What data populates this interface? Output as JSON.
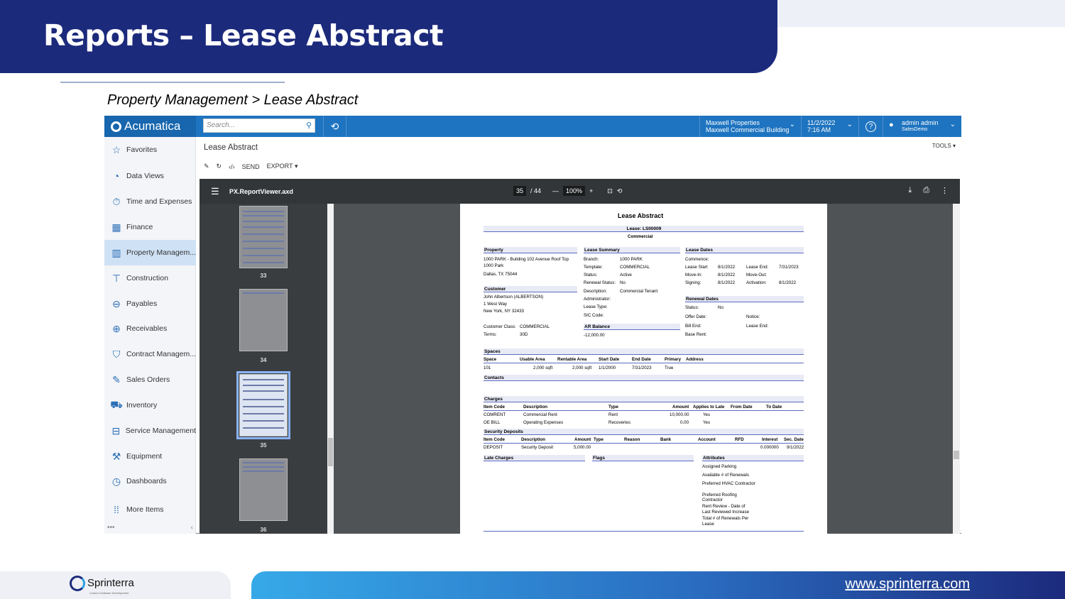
{
  "slide": {
    "title": "Reports – Lease Abstract",
    "breadcrumb": "Property Management > Lease Abstract",
    "url": "www.sprinterra.com",
    "brand": "Sprinterra",
    "brand_tagline": "Custom Software Development"
  },
  "app": {
    "logo": "Acumatica",
    "search_placeholder": "Search...",
    "company": "Maxwell Properties",
    "branch": "Maxwell Commercial Building",
    "date": "11/2/2022",
    "time": "7:16 AM",
    "user": "admin admin",
    "tenant": "SalesDemo"
  },
  "sidebar": {
    "items": [
      {
        "label": "Favorites",
        "icon": "star-icon"
      },
      {
        "label": "Data Views",
        "icon": "pie-chart-icon"
      },
      {
        "label": "Time and Expenses",
        "icon": "stopwatch-icon"
      },
      {
        "label": "Finance",
        "icon": "calculator-icon"
      },
      {
        "label": "Property Managem...",
        "icon": "building-icon"
      },
      {
        "label": "Construction",
        "icon": "crane-icon"
      },
      {
        "label": "Payables",
        "icon": "minus-circle-icon"
      },
      {
        "label": "Receivables",
        "icon": "plus-circle-icon"
      },
      {
        "label": "Contract Managem...",
        "icon": "handshake-icon"
      },
      {
        "label": "Sales Orders",
        "icon": "pencil-icon"
      },
      {
        "label": "Inventory",
        "icon": "truck-icon"
      },
      {
        "label": "Service Management",
        "icon": "toolbox-icon"
      },
      {
        "label": "Equipment",
        "icon": "wrench-icon"
      },
      {
        "label": "Dashboards",
        "icon": "gauge-icon"
      },
      {
        "label": "More Items",
        "icon": "grid-dots-icon"
      }
    ]
  },
  "screen": {
    "title": "Lease Abstract",
    "tools": "TOOLS",
    "send": "SEND",
    "export": "EXPORT"
  },
  "viewer": {
    "filename": "PX.ReportViewer.axd",
    "page": "35",
    "total": "/ 44",
    "zoom": "100%",
    "thumbs": [
      "33",
      "34",
      "35",
      "36"
    ]
  },
  "report": {
    "title": "Lease Abstract",
    "lease": "Lease: LS00009",
    "type": "Commercial",
    "property_h": "Property",
    "property": [
      "1000 PARK - Building 102 Avenue Roof Top",
      "1000 Park",
      "Dallas, TX 75044"
    ],
    "customer_h": "Customer",
    "customer": [
      "John Albertson (ALBERTSON)",
      "1 West Way",
      "New York, NY 32433"
    ],
    "cust_class_l": "Customer Class:",
    "cust_class": "COMMERCIAL",
    "terms_l": "Terms:",
    "terms": "30D",
    "summary_h": "Lease Summary",
    "summary": [
      {
        "l": "Branch:",
        "v": "1000 PARK"
      },
      {
        "l": "Template:",
        "v": "COMMERCIAL"
      },
      {
        "l": "Status:",
        "v": "Active"
      },
      {
        "l": "Renewal Status:",
        "v": "No"
      },
      {
        "l": "Description:",
        "v": "Commercial Tenant"
      },
      {
        "l": "Administrator:",
        "v": ""
      },
      {
        "l": "Lease Type:",
        "v": ""
      },
      {
        "l": "SIC Code:",
        "v": ""
      }
    ],
    "ar_h": "AR Balance",
    "ar": "-12,000.00",
    "dates_h": "Lease Dates",
    "commence": "Commence:",
    "dates": [
      {
        "l": "Lease Start",
        "v": "8/1/2022",
        "l2": "Lease End:",
        "v2": "7/31/2023"
      },
      {
        "l": "Move-In:",
        "v": "8/1/2022",
        "l2": "Move-Out:",
        "v2": ""
      },
      {
        "l": "Signing:",
        "v": "8/1/2022",
        "l2": "Activation:",
        "v2": "8/1/2022"
      }
    ],
    "renewal_h": "Renewal Dates",
    "ren_status_l": "Status:",
    "ren_status": "No",
    "offer_l": "Offer Date:",
    "notice_l": "Notice:",
    "billend_l": "Bill End:",
    "leaseend_l": "Lease End:",
    "baserent_l": "Base Rent:",
    "spaces_h": "Spaces",
    "spaces_cols": [
      "Space",
      "Usable Area",
      "Rentable Area",
      "Start Date",
      "End Date",
      "Primary",
      "Address"
    ],
    "spaces_row": [
      "101",
      "2,000 sqft",
      "2,000 sqft",
      "1/1/2000",
      "7/31/2023",
      "True",
      ""
    ],
    "contacts_h": "Contacts",
    "charges_h": "Charges",
    "charges_cols": [
      "Item Code",
      "Description",
      "Type",
      "Amount",
      "Applies to Late",
      "From Date",
      "To Date"
    ],
    "charges_rows": [
      [
        "COMRENT",
        "Commercial Rent",
        "Rent",
        "10,000.00",
        "Yes"
      ],
      [
        "OE BILL",
        "Operating Expenses",
        "Recoveries",
        "0.00",
        "Yes"
      ]
    ],
    "deposits_h": "Security Deposits",
    "deposits_cols": [
      "Item Code",
      "Description",
      "Amount",
      "Type",
      "Reason",
      "Bank",
      "Account",
      "RFD",
      "Interest",
      "Sec. Date"
    ],
    "deposits_row": [
      "DEPOSIT",
      "Security Deposit",
      "5,000.00",
      "0.000000",
      "9/1/2022"
    ],
    "late_h": "Late Charges",
    "flags_h": "Flags",
    "attr_h": "Attributes",
    "attrs": [
      "Assigned Parking",
      "Available # of Renewals",
      "Preferred HVAC Contractor",
      "Preferred Roofing",
      "Contractor",
      "Rent Review - Date of",
      "Last Reviewed Increase",
      "Total # of Renewals Per",
      "Lease"
    ]
  }
}
